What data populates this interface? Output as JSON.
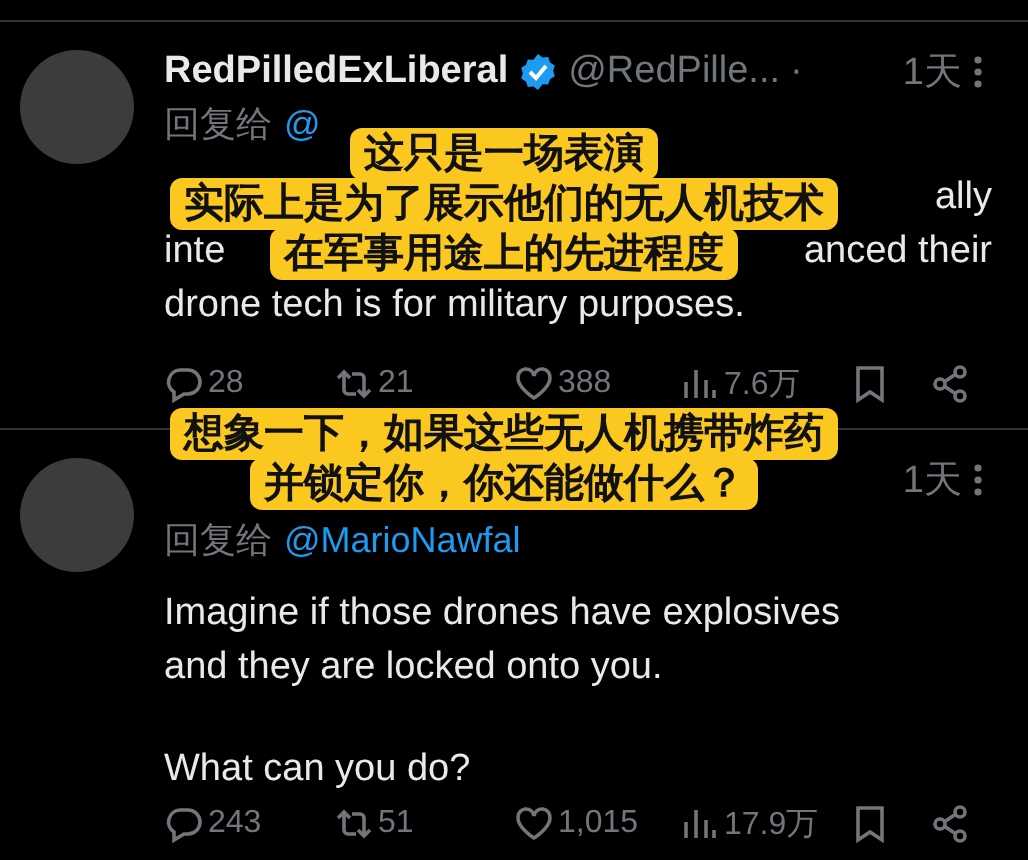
{
  "tweets": [
    {
      "author": {
        "name": "RedPilledExLiberal",
        "verified": true,
        "handle": "@RedPille...",
        "separator": "·",
        "time": "1天"
      },
      "reply_to": {
        "label": "回复给",
        "handle": "@"
      },
      "paragraphs": [
        {
          "lines": [
            {
              "right": "ally"
            },
            {
              "left": "inte",
              "right": "anced their"
            },
            {
              "left": "drone tech is for military purposes."
            }
          ]
        }
      ],
      "actions": [
        {
          "kind": "reply",
          "count": "28"
        },
        {
          "kind": "repost",
          "count": "21"
        },
        {
          "kind": "like",
          "count": "388"
        },
        {
          "kind": "views",
          "count": "7.6万"
        },
        {
          "kind": "bookmark"
        },
        {
          "kind": "share"
        }
      ]
    },
    {
      "author": {
        "time": "1天"
      },
      "reply_to": {
        "label": "回复给",
        "handle": "@MarioNawfal"
      },
      "paragraphs": [
        {
          "lines": [
            {
              "left": "Imagine if those drones have explosives"
            },
            {
              "left": "and they are locked onto you."
            }
          ]
        },
        {
          "lines": [
            {
              "left": "What can you do?"
            }
          ]
        }
      ],
      "actions": [
        {
          "kind": "reply",
          "count": "243"
        },
        {
          "kind": "repost",
          "count": "51"
        },
        {
          "kind": "like",
          "count": "1,015"
        },
        {
          "kind": "views",
          "count": "17.9万"
        },
        {
          "kind": "bookmark"
        },
        {
          "kind": "share"
        }
      ]
    }
  ],
  "subtitles": [
    {
      "lines": [
        "这只是一场表演",
        "实际上是为了展示他们的无人机技术",
        "在军事用途上的先进程度"
      ]
    },
    {
      "lines": [
        "想象一下，如果这些无人机携带炸药",
        "并锁定你，你还能做什么？"
      ]
    }
  ]
}
